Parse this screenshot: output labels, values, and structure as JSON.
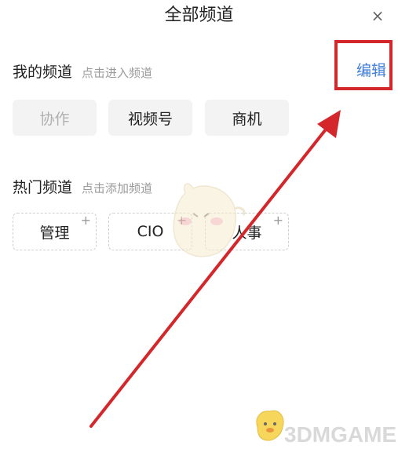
{
  "header": {
    "title": "全部频道",
    "close_icon": "close-icon",
    "close_glyph": "×"
  },
  "my_channels": {
    "title": "我的频道",
    "hint": "点击进入频道",
    "edit_label": "编辑",
    "items": [
      {
        "label": "协作",
        "state": "disabled"
      },
      {
        "label": "视频号",
        "state": "normal"
      },
      {
        "label": "商机",
        "state": "normal"
      }
    ]
  },
  "hot_channels": {
    "title": "热门频道",
    "hint": "点击添加频道",
    "add_glyph": "+",
    "items": [
      {
        "label": "管理"
      },
      {
        "label": "CIO"
      },
      {
        "label": "人事"
      }
    ]
  },
  "annotation": {
    "highlight_color": "#d4272b",
    "arrow_color": "#d4272b"
  },
  "watermark": {
    "text": "3DMGAME"
  },
  "colors": {
    "accent_link": "#3f7ddb",
    "hint_text": "#9a9a9a",
    "chip_bg": "#f3f3f3"
  }
}
